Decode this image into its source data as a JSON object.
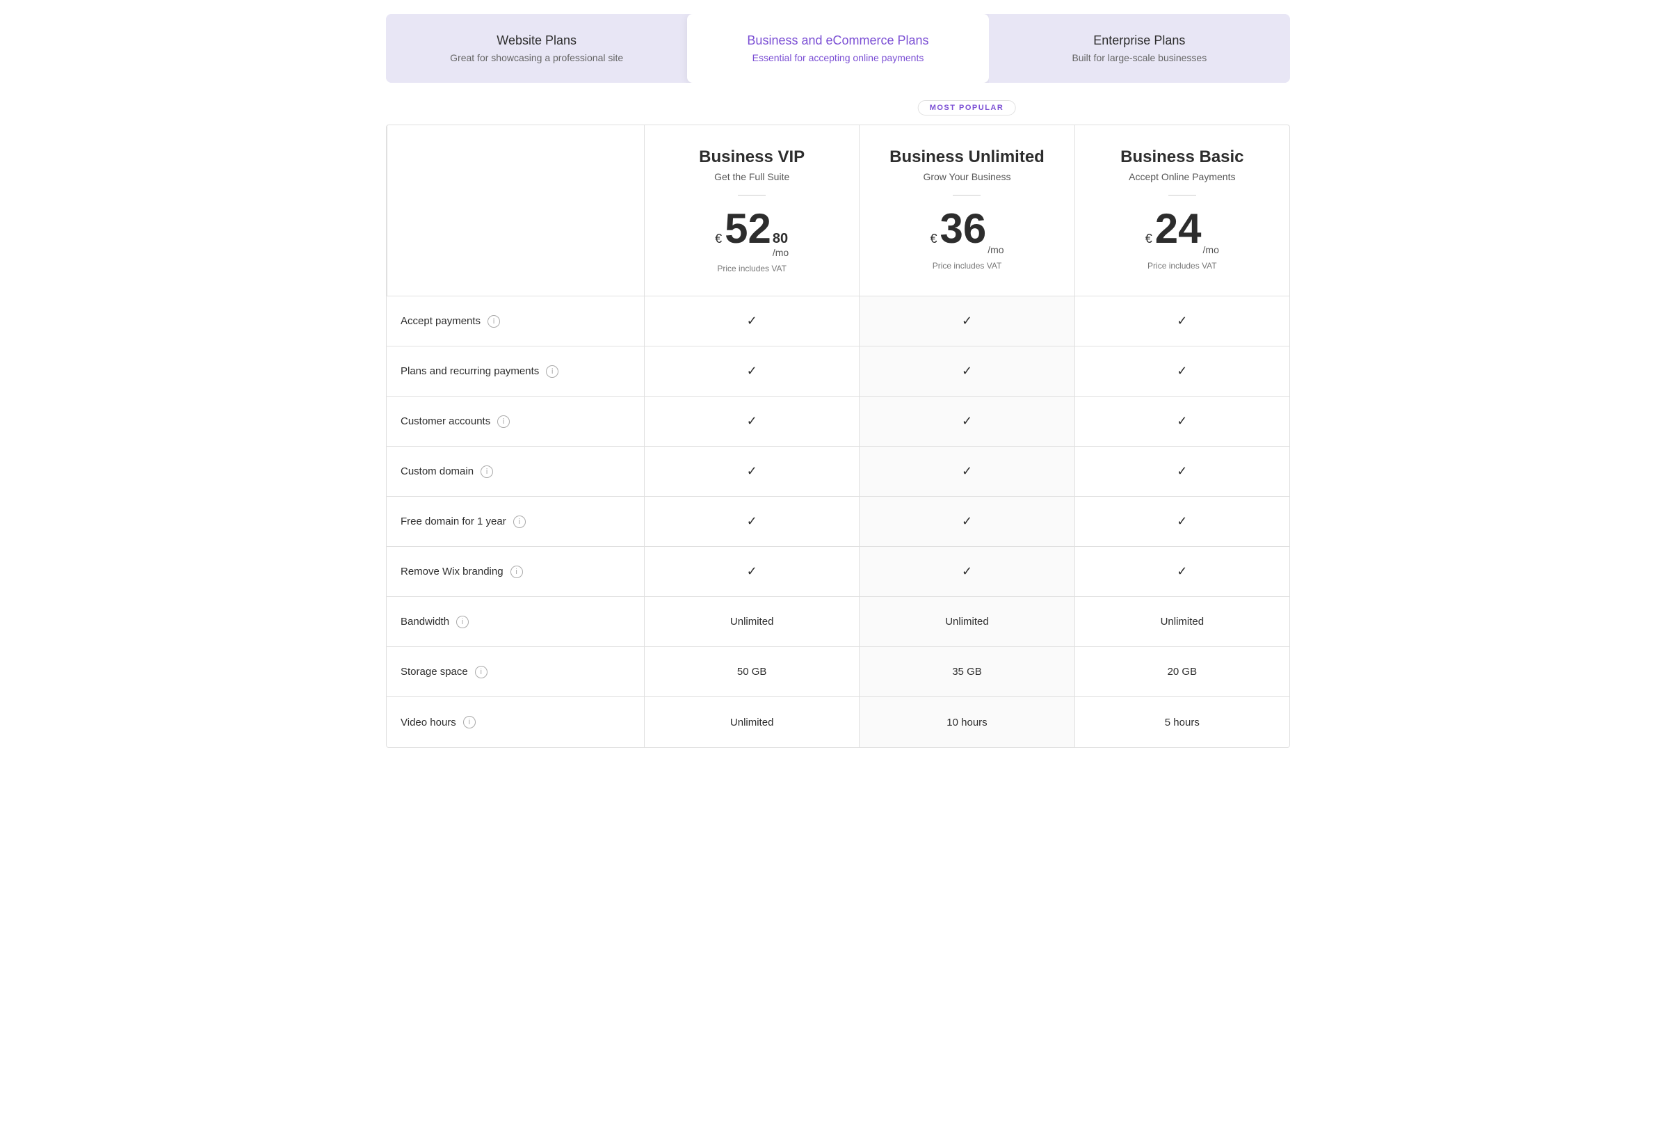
{
  "tabs": [
    {
      "id": "website",
      "title": "Website Plans",
      "subtitle": "Great for showcasing a professional site",
      "active": false
    },
    {
      "id": "business",
      "title": "Business and eCommerce Plans",
      "subtitle": "Essential for accepting online payments",
      "active": true
    },
    {
      "id": "enterprise",
      "title": "Enterprise Plans",
      "subtitle": "Built for large-scale businesses",
      "active": false
    }
  ],
  "most_popular_label": "MOST POPULAR",
  "plans": [
    {
      "id": "vip",
      "name": "Business VIP",
      "tagline": "Get the Full Suite",
      "currency": "€",
      "price_main": "52",
      "price_cents": "80",
      "price_mo": "/mo",
      "price_vat": "Price includes VAT",
      "popular": false
    },
    {
      "id": "unlimited",
      "name": "Business Unlimited",
      "tagline": "Grow Your Business",
      "currency": "€",
      "price_main": "36",
      "price_cents": "",
      "price_mo": "/mo",
      "price_vat": "Price includes VAT",
      "popular": true
    },
    {
      "id": "basic",
      "name": "Business Basic",
      "tagline": "Accept Online Payments",
      "currency": "€",
      "price_main": "24",
      "price_cents": "",
      "price_mo": "/mo",
      "price_vat": "Price includes VAT",
      "popular": false
    }
  ],
  "features": [
    {
      "label": "Accept payments",
      "values": [
        "check",
        "check",
        "check"
      ]
    },
    {
      "label": "Plans and recurring payments",
      "values": [
        "check",
        "check",
        "check"
      ]
    },
    {
      "label": "Customer accounts",
      "values": [
        "check",
        "check",
        "check"
      ]
    },
    {
      "label": "Custom domain",
      "values": [
        "check",
        "check",
        "check"
      ]
    },
    {
      "label": "Free domain for 1 year",
      "values": [
        "check",
        "check",
        "check"
      ]
    },
    {
      "label": "Remove Wix branding",
      "values": [
        "check",
        "check",
        "check"
      ]
    },
    {
      "label": "Bandwidth",
      "values": [
        "Unlimited",
        "Unlimited",
        "Unlimited"
      ]
    },
    {
      "label": "Storage space",
      "values": [
        "50 GB",
        "35 GB",
        "20 GB"
      ]
    },
    {
      "label": "Video hours",
      "values": [
        "Unlimited",
        "10 hours",
        "5 hours"
      ]
    }
  ],
  "accent_color": "#7b4fd4"
}
